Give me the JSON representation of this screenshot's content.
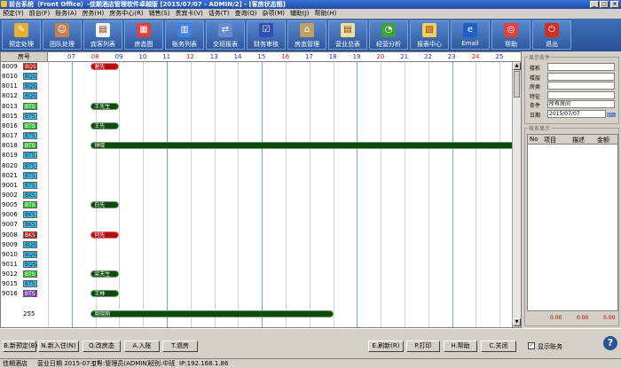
{
  "window": {
    "title": "前台系统（Front Office）-佳期酒店管理软件卓越版 [2015/07/07 - ADMIN/2] - [客房状态图]",
    "controls": [
      "_",
      "□",
      "×"
    ]
  },
  "menu": [
    "预定(Y)",
    "前台(F)",
    "账务(A)",
    "房务(H)",
    "房务中心(R)",
    "销售(S)",
    "贵宾卡(V)",
    "话务(T)",
    "查询(Q)",
    "杂项(M)",
    "辅助(J)",
    "帮助(H)"
  ],
  "toolbar": [
    {
      "label": "预定处理",
      "icon": "reservation-icon",
      "color": "#e8b030",
      "glyph": "✎"
    },
    {
      "label": "团队处理",
      "icon": "group-icon",
      "color": "#c08050",
      "glyph": "☺"
    },
    {
      "label": "宾客列表",
      "icon": "guest-list-icon",
      "color": "#f0f0f0",
      "glyph": "▤"
    },
    {
      "label": "房态图",
      "icon": "room-status-icon",
      "color": "#e04040",
      "glyph": "▦"
    },
    {
      "label": "账务列表",
      "icon": "account-list-icon",
      "color": "#4080e0",
      "glyph": "▥"
    },
    {
      "label": "交班报表",
      "icon": "shift-report-icon",
      "color": "#6a8ad0",
      "glyph": "⇄"
    },
    {
      "label": "财务审核",
      "icon": "audit-icon",
      "color": "#3050b0",
      "glyph": "☑"
    },
    {
      "label": "房态管理",
      "icon": "room-manage-icon",
      "color": "#c0a060",
      "glyph": "⌂"
    },
    {
      "label": "营业总表",
      "icon": "business-summary-icon",
      "color": "#f0e0a0",
      "glyph": "▤"
    },
    {
      "label": "经营分析",
      "icon": "analysis-icon",
      "color": "#40a040",
      "glyph": "◔"
    },
    {
      "label": "报表中心",
      "icon": "report-center-icon",
      "color": "#f0d060",
      "glyph": "▧"
    },
    {
      "label": "Email",
      "icon": "email-icon",
      "color": "#2060c0",
      "glyph": "e"
    },
    {
      "label": "帮助",
      "icon": "help-icon",
      "color": "#e04040",
      "glyph": "◎"
    },
    {
      "label": "退出",
      "icon": "exit-icon",
      "color": "#d03020",
      "glyph": "⏻"
    }
  ],
  "grid": {
    "room_header": "房号",
    "hours": [
      "07",
      "08",
      "09",
      "10",
      "11",
      "12",
      "13",
      "14",
      "15",
      "16",
      "17",
      "18",
      "19",
      "20",
      "21",
      "22",
      "23",
      "24",
      "25"
    ],
    "rooms": [
      {
        "no": "8009",
        "type": "BQS",
        "color": "#c01010"
      },
      {
        "no": "8010",
        "type": "BQS",
        "color": "#40c0e0"
      },
      {
        "no": "8011",
        "type": "BQS",
        "color": "#40c0e0"
      },
      {
        "no": "8012",
        "type": "BQS",
        "color": "#40c0e0"
      },
      {
        "no": "8013",
        "type": "BTS",
        "color": "#30c030"
      },
      {
        "no": "8015",
        "type": "BTS",
        "color": "#40c0e0"
      },
      {
        "no": "8016",
        "type": "BTS",
        "color": "#30c030"
      },
      {
        "no": "8017",
        "type": "BTS",
        "color": "#40c0e0"
      },
      {
        "no": "8018",
        "type": "BTS",
        "color": "#30c030"
      },
      {
        "no": "8019",
        "type": "BTS",
        "color": "#40c0e0"
      },
      {
        "no": "8020",
        "type": "BTS",
        "color": "#40c0e0"
      },
      {
        "no": "8021",
        "type": "BTS",
        "color": "#40c0e0"
      },
      {
        "no": "9001",
        "type": "BTS",
        "color": "#40c0e0"
      },
      {
        "no": "9002",
        "type": "BKS",
        "color": "#40c0e0"
      },
      {
        "no": "9005",
        "type": "BTS",
        "color": "#30c030"
      },
      {
        "no": "9006",
        "type": "BKS",
        "color": "#40c0e0"
      },
      {
        "no": "9007",
        "type": "BKS",
        "color": "#40c0e0"
      },
      {
        "no": "9008",
        "type": "BKS",
        "color": "#c01010"
      },
      {
        "no": "9009",
        "type": "BQS",
        "color": "#40c0e0"
      },
      {
        "no": "9010",
        "type": "BQS",
        "color": "#40c0e0"
      },
      {
        "no": "9011",
        "type": "BQS",
        "color": "#40c0e0"
      },
      {
        "no": "9012",
        "type": "BTS",
        "color": "#30c030"
      },
      {
        "no": "9015",
        "type": "BTS",
        "color": "#40c0e0"
      },
      {
        "no": "9016",
        "type": "BTS",
        "color": "#8040c0"
      }
    ],
    "row_255": "255",
    "bars": [
      {
        "row": 0,
        "text": "谢先",
        "start": 1.8,
        "end": 3.0,
        "red": true
      },
      {
        "row": 4,
        "text": "王先生",
        "start": 1.8,
        "end": 3.0,
        "red": false
      },
      {
        "row": 6,
        "text": "王先",
        "start": 1.8,
        "end": 3.0,
        "red": false
      },
      {
        "row": 8,
        "text": "钟晓",
        "start": 1.8,
        "end": 21.0,
        "red": false
      },
      {
        "row": 14,
        "text": "白先",
        "start": 1.8,
        "end": 3.0,
        "red": false
      },
      {
        "row": 17,
        "text": "何先",
        "start": 1.8,
        "end": 3.0,
        "red": true
      },
      {
        "row": 21,
        "text": "梁天生",
        "start": 1.8,
        "end": 3.0,
        "red": false
      },
      {
        "row": 23,
        "text": "王林",
        "start": 1.8,
        "end": 3.0,
        "red": false
      },
      {
        "row": 25,
        "text": "周晓刚",
        "start": 1.8,
        "end": 12.0,
        "red": false
      }
    ]
  },
  "filter": {
    "title": "显示条件",
    "fields": [
      {
        "label": "楼栋",
        "value": ""
      },
      {
        "label": "楼层",
        "value": ""
      },
      {
        "label": "房类",
        "value": ""
      },
      {
        "label": "特征",
        "value": ""
      },
      {
        "label": "条件",
        "value": "所有房间"
      },
      {
        "label": "日期",
        "value": "2015/07/07"
      }
    ]
  },
  "accounts": {
    "title": "账务显示",
    "headers": [
      "No",
      "项目",
      "描述",
      "金额"
    ],
    "totals": [
      "0.00",
      "0.00",
      "0.00"
    ]
  },
  "bottom_buttons": [
    {
      "label": "B.新预定(B)",
      "name": "new-reservation-button"
    },
    {
      "label": "N.新入住(N)",
      "name": "new-checkin-button"
    },
    {
      "label": "Q.改房态",
      "name": "change-status-button"
    },
    {
      "label": "A.入账",
      "name": "post-account-button"
    },
    {
      "label": "T.退房",
      "name": "checkout-button"
    },
    {
      "label": "E.刷新(R)",
      "name": "refresh-button"
    },
    {
      "label": "P.打印",
      "name": "print-button"
    },
    {
      "label": "H.帮助",
      "name": "help-button"
    },
    {
      "label": "C.关闭",
      "name": "close-button"
    }
  ],
  "show_accounts_label": "显示账务",
  "status": [
    "佳期酒店",
    "营业日期 2015-07-07",
    "工号:管理员(ADMIN)",
    "班别:中班",
    "IP:192.168.1.86"
  ]
}
